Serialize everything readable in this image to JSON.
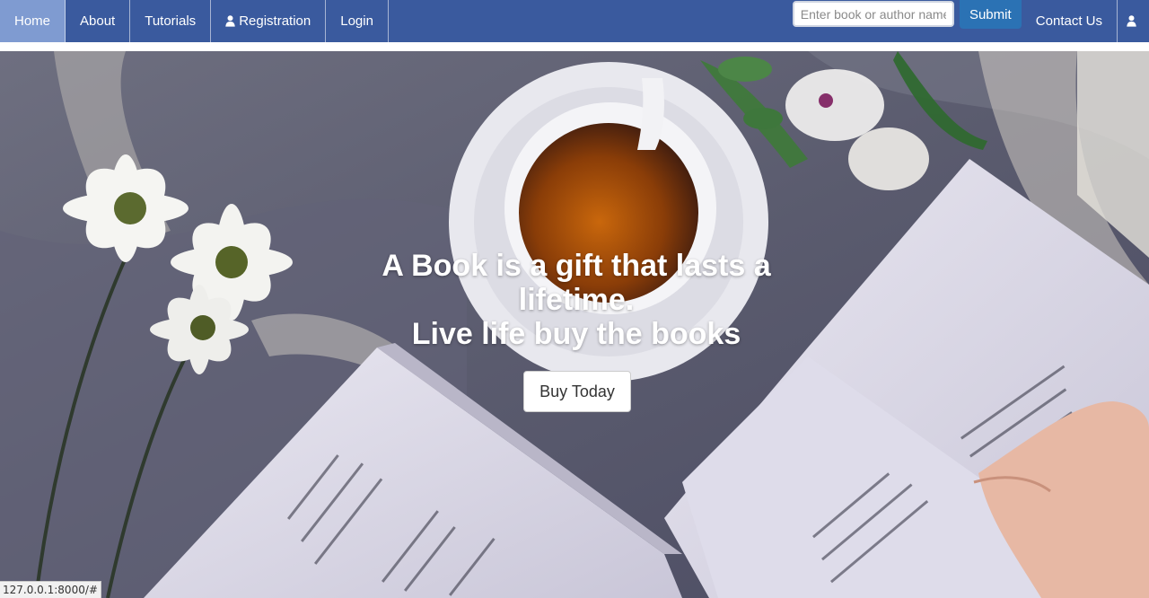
{
  "navbar": {
    "items": [
      {
        "label": "Home",
        "active": true
      },
      {
        "label": "About"
      },
      {
        "label": "Tutorials"
      },
      {
        "label": "Registration",
        "icon": "user-icon"
      },
      {
        "label": "Login"
      }
    ],
    "search": {
      "placeholder": "Enter book or author name",
      "value": "",
      "submit_label": "Submit"
    },
    "contact_label": "Contact Us",
    "right_icon": "user-icon",
    "bg_color": "#3a5a9e",
    "active_color": "#7f9bd1",
    "submit_color": "#2b72b4"
  },
  "hero": {
    "headline": "A Book is a gift that lasts a lifetime.",
    "subheadline": "Live life buy the books",
    "button_label": "Buy Today"
  },
  "status_bar": {
    "url": "127.0.0.1:8000/#"
  }
}
